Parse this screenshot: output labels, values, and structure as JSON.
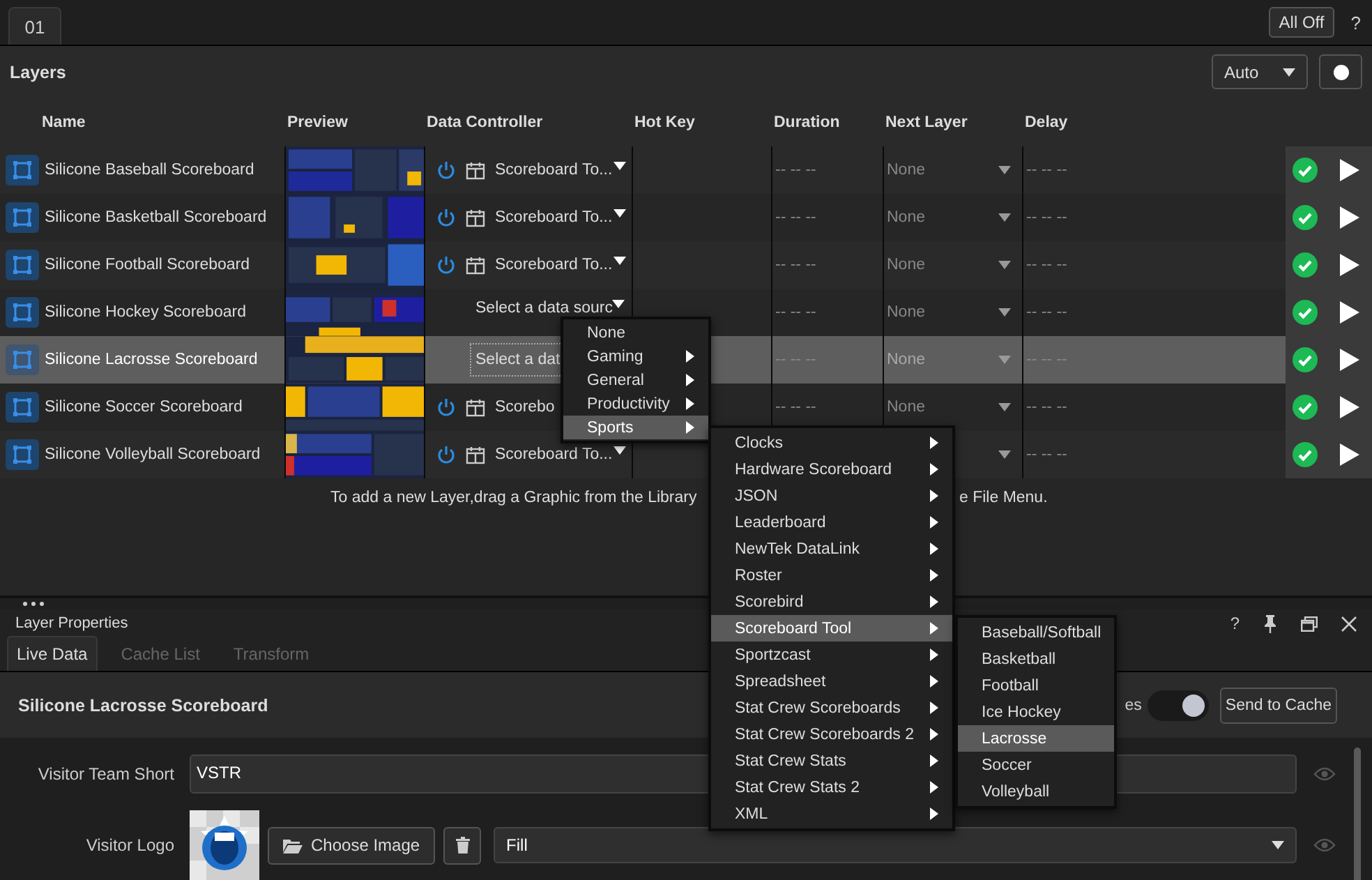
{
  "tabs": [
    {
      "label": "01",
      "selected": true
    }
  ],
  "toolbar": {
    "all_off": "All Off",
    "help": "?"
  },
  "layers": {
    "title": "Layers",
    "mode": "Auto",
    "columns": [
      "Name",
      "Preview",
      "Data Controller",
      "Hot Key",
      "Duration",
      "Next Layer",
      "Delay"
    ],
    "rows": [
      {
        "name": "Silicone Baseball Scoreboard",
        "selected": false,
        "controller": {
          "kind": "source",
          "label": "Scoreboard To...",
          "arrow": true
        },
        "duration": "-- -- --",
        "next_layer": "None",
        "delay": "-- -- --"
      },
      {
        "name": "Silicone Basketball Scoreboard",
        "selected": false,
        "controller": {
          "kind": "source",
          "label": "Scoreboard To...",
          "arrow": true
        },
        "duration": "-- -- --",
        "next_layer": "None",
        "delay": "-- -- --"
      },
      {
        "name": "Silicone Football Scoreboard",
        "selected": false,
        "controller": {
          "kind": "source",
          "label": "Scoreboard To...",
          "arrow": true
        },
        "duration": "-- -- --",
        "next_layer": "None",
        "delay": "-- -- --"
      },
      {
        "name": "Silicone Hockey Scoreboard",
        "selected": false,
        "controller": {
          "kind": "prompt",
          "label": "Select a data sourc",
          "focused": false,
          "arrow": true
        },
        "duration": "-- -- --",
        "next_layer": "None",
        "delay": "-- -- --"
      },
      {
        "name": "Silicone Lacrosse Scoreboard",
        "selected": true,
        "controller": {
          "kind": "prompt",
          "label": "Select a dat",
          "focused": true,
          "arrow": false
        },
        "duration": "-- -- --",
        "next_layer": "None",
        "delay": "-- -- --"
      },
      {
        "name": "Silicone Soccer Scoreboard",
        "selected": false,
        "controller": {
          "kind": "source",
          "label": "Scorebo",
          "arrow": false
        },
        "duration": "-- -- --",
        "next_layer": "None",
        "delay": "-- -- --"
      },
      {
        "name": "Silicone Volleyball Scoreboard",
        "selected": false,
        "controller": {
          "kind": "source",
          "label": "Scoreboard To...",
          "arrow": true
        },
        "delay": "-- -- --"
      }
    ],
    "hint": [
      "To add a new Layer,drag a Graphic from the Library",
      "e File Menu."
    ]
  },
  "menus": [
    {
      "items": [
        {
          "label": "None",
          "submenu": false,
          "selected": false
        },
        {
          "label": "Gaming",
          "submenu": true,
          "selected": false
        },
        {
          "label": "General",
          "submenu": true,
          "selected": false
        },
        {
          "label": "Productivity",
          "submenu": true,
          "selected": false
        },
        {
          "label": "Sports",
          "submenu": true,
          "selected": true
        }
      ]
    },
    {
      "items": [
        {
          "label": "Clocks",
          "submenu": true,
          "selected": false
        },
        {
          "label": "Hardware Scoreboard",
          "submenu": true,
          "selected": false
        },
        {
          "label": "JSON",
          "submenu": true,
          "selected": false
        },
        {
          "label": "Leaderboard",
          "submenu": true,
          "selected": false
        },
        {
          "label": "NewTek DataLink",
          "submenu": true,
          "selected": false
        },
        {
          "label": "Roster",
          "submenu": true,
          "selected": false
        },
        {
          "label": "Scorebird",
          "submenu": true,
          "selected": false
        },
        {
          "label": "Scoreboard Tool",
          "submenu": true,
          "selected": true
        },
        {
          "label": "Sportzcast",
          "submenu": true,
          "selected": false
        },
        {
          "label": "Spreadsheet",
          "submenu": true,
          "selected": false
        },
        {
          "label": "Stat Crew Scoreboards",
          "submenu": true,
          "selected": false
        },
        {
          "label": "Stat Crew Scoreboards 2",
          "submenu": true,
          "selected": false
        },
        {
          "label": "Stat Crew Stats",
          "submenu": true,
          "selected": false
        },
        {
          "label": "Stat Crew Stats 2",
          "submenu": true,
          "selected": false
        },
        {
          "label": "XML",
          "submenu": true,
          "selected": false
        }
      ]
    },
    {
      "items": [
        {
          "label": "Baseball/Softball",
          "submenu": false,
          "selected": false
        },
        {
          "label": "Basketball",
          "submenu": false,
          "selected": false
        },
        {
          "label": "Football",
          "submenu": false,
          "selected": false
        },
        {
          "label": "Ice Hockey",
          "submenu": false,
          "selected": false
        },
        {
          "label": "Lacrosse",
          "submenu": false,
          "selected": true
        },
        {
          "label": "Soccer",
          "submenu": false,
          "selected": false
        },
        {
          "label": "Volleyball",
          "submenu": false,
          "selected": false
        }
      ]
    }
  ],
  "properties": {
    "title": "Layer Properties",
    "help": "?",
    "tabs": [
      {
        "label": "Live Data",
        "selected": true
      },
      {
        "label": "Cache List",
        "selected": false
      },
      {
        "label": "Transform",
        "selected": false
      }
    ],
    "layer_name": "Silicone Lacrosse Scoreboard",
    "toggle_label": "es",
    "toggle_on": true,
    "send": "Send to Cache",
    "fields": [
      {
        "kind": "text",
        "label": "Visitor Team Short",
        "value": "VSTR"
      },
      {
        "label": "Visitor Logo",
        "button": "Choose Image",
        "fit": "Fill"
      }
    ]
  }
}
